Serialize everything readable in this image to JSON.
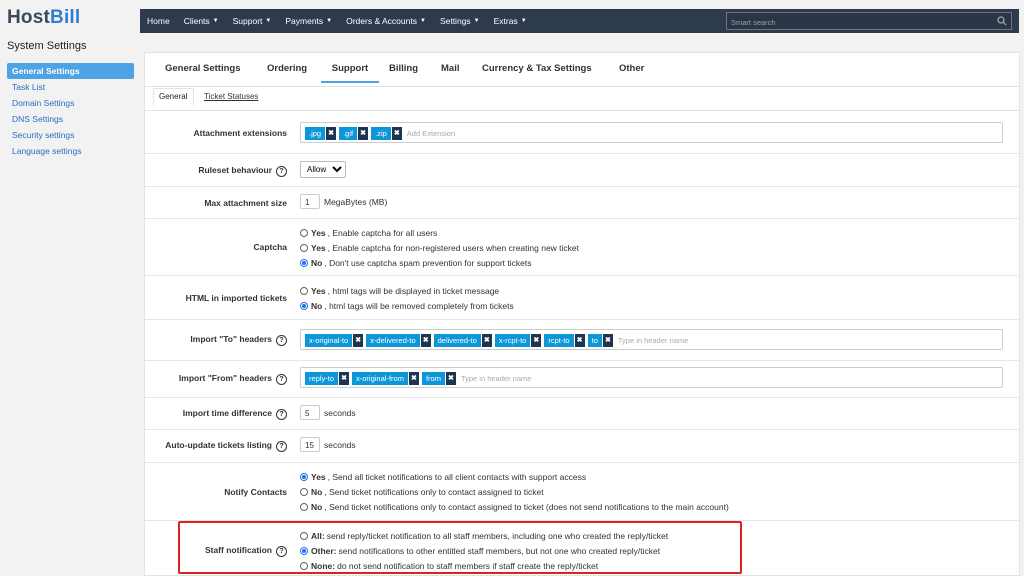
{
  "app": {
    "logo_main": "Host",
    "logo_accent": "Bill",
    "section_title": "System Settings"
  },
  "sidebar": {
    "items": [
      {
        "label": "General Settings",
        "active": true
      },
      {
        "label": "Task List"
      },
      {
        "label": "Domain Settings"
      },
      {
        "label": "DNS Settings"
      },
      {
        "label": "Security settings"
      },
      {
        "label": "Language settings"
      }
    ]
  },
  "topnav": {
    "items": [
      "Home",
      "Clients",
      "Support",
      "Payments",
      "Orders & Accounts",
      "Settings",
      "Extras"
    ],
    "search_placeholder": "Smart search"
  },
  "tabs": [
    "General Settings",
    "Ordering",
    "Support",
    "Billing",
    "Mail",
    "Currency & Tax Settings",
    "Other"
  ],
  "active_tab": "Support",
  "subtabs": [
    "General",
    "Ticket Statuses"
  ],
  "settings": {
    "attachment_extensions": {
      "label": "Attachment extensions",
      "tags": [
        ".jpg",
        ".gif",
        ".zip"
      ],
      "placeholder": "Add Extension"
    },
    "ruleset": {
      "label": "Ruleset behaviour",
      "value": "Allow"
    },
    "max_attachment": {
      "label": "Max attachment size",
      "value": "1",
      "unit": "MegaBytes (MB)"
    },
    "captcha": {
      "label": "Captcha",
      "options": [
        {
          "bold": "Yes",
          "text": ", Enable captcha for all users"
        },
        {
          "bold": "Yes",
          "text": ", Enable captcha for non-registered users when creating new ticket"
        },
        {
          "bold": "No",
          "text": ", Don't use captcha spam prevention for support tickets",
          "selected": true
        }
      ]
    },
    "html_imported": {
      "label": "HTML in imported tickets",
      "options": [
        {
          "bold": "Yes",
          "text": ", html tags will be displayed in ticket message"
        },
        {
          "bold": "No",
          "text": ", html tags will be removed completely from tickets",
          "selected": true
        }
      ]
    },
    "import_to": {
      "label": "Import \"To\" headers",
      "tags": [
        "x-original-to",
        "x-delivered-to",
        "delivered-to",
        "x-rcpt-to",
        "rcpt-to",
        "to"
      ],
      "placeholder": "Type in header name"
    },
    "import_from": {
      "label": "Import \"From\" headers",
      "tags": [
        "reply-to",
        "x-original-from",
        "from"
      ],
      "placeholder": "Type in header name"
    },
    "import_time": {
      "label": "Import time difference",
      "value": "5",
      "unit": "seconds"
    },
    "auto_update": {
      "label": "Auto-update tickets listing",
      "value": "15",
      "unit": "seconds"
    },
    "notify_contacts": {
      "label": "Notify Contacts",
      "options": [
        {
          "bold": "Yes",
          "text": ", Send all ticket notifications to all client contacts with support access",
          "selected": true
        },
        {
          "bold": "No",
          "text": ", Send ticket notifications only to contact assigned to ticket"
        },
        {
          "bold": "No",
          "text": ", Send ticket notifications only to contact assigned to ticket (does not send notifications to the main account)"
        }
      ]
    },
    "staff_notification": {
      "label": "Staff notification",
      "options": [
        {
          "bold": "All:",
          "text": " send reply/ticket notification to all staff members, including one who created the reply/ticket"
        },
        {
          "bold": "Other:",
          "text": " send notifications to other entitled staff members, but not one who created reply/ticket",
          "selected": true
        },
        {
          "bold": "None:",
          "text": " do not send notification to staff members if staff create the reply/ticket"
        }
      ]
    }
  },
  "colors": {
    "topbar": "#2e3b4e",
    "accent": "#4da3e4",
    "tag": "#0d97d9",
    "highlight": "#e0221e"
  }
}
